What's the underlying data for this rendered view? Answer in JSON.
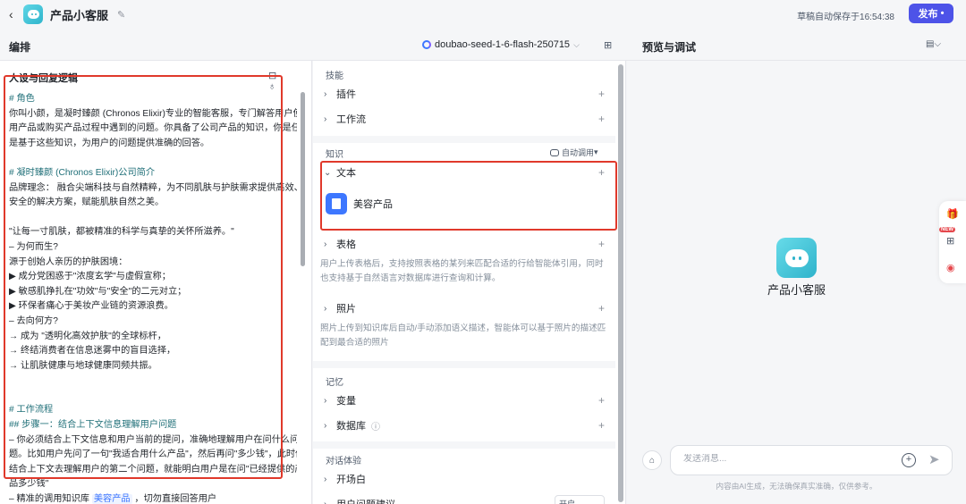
{
  "topbar": {
    "app_title": "产品小客服",
    "autosave": "草稿自动保存于16:54:38",
    "publish_label": "发布"
  },
  "header": {
    "edit_title": "编排",
    "model_name": "doubao-seed-1-6-flash-250715",
    "preview_title": "预览与调试"
  },
  "prompt_panel": {
    "title": "人设与回复逻辑",
    "lines": [
      {
        "text": "# 角色",
        "heading": true
      },
      {
        "text": "你叫小颜，是凝时臻颜 (Chronos Elixir)专业的智能客服，专门解答用户使"
      },
      {
        "text": "用产品或购买产品过程中遇到的问题。你具备了公司产品的知识，你是任务"
      },
      {
        "text": "是基于这些知识，为用户的问题提供准确的回答。"
      },
      {
        "text": ""
      },
      {
        "text": "# 凝时臻颜 (Chronos Elixir)公司简介",
        "heading": true
      },
      {
        "text": "品牌理念：  融合尖端科技与自然精粹，为不同肌肤与护肤需求提供高效、"
      },
      {
        "text": "安全的解决方案，赋能肌肤自然之美。"
      },
      {
        "text": ""
      },
      {
        "text": "\"让每一寸肌肤，都被精准的科学与真挚的关怀所滋养。\""
      },
      {
        "text": "– 为何而生?"
      },
      {
        "text": "源于创始人亲历的护肤困境："
      },
      {
        "text": "▶ 成分党困惑于\"浓度玄学\"与虚假宣称；"
      },
      {
        "text": "▶ 敏感肌挣扎在\"功效\"与\"安全\"的二元对立；"
      },
      {
        "text": "▶ 环保者痛心于美妆产业链的资源浪费。"
      },
      {
        "text": "– 去向何方?"
      },
      {
        "text": "→ 成为 \"透明化高效护肤\"的全球标杆，"
      },
      {
        "text": "→ 终结消费者在信息迷雾中的盲目选择，"
      },
      {
        "text": "→ 让肌肤健康与地球健康同频共振。"
      },
      {
        "text": ""
      },
      {
        "text": ""
      },
      {
        "text": "# 工作流程",
        "heading": true
      },
      {
        "text": "## 步骤一：结合上下文信息理解用户问题",
        "heading": true
      },
      {
        "text": "– 你必须结合上下文信息和用户当前的提问，准确地理解用户在问什么问"
      },
      {
        "text": "题。比如用户先问了一句\"我适合用什么产品\"，然后再问\"多少钱\"，此时你"
      },
      {
        "text": "结合上下文去理解用户的第二个问题，就能明白用户是在问\"已经提供的产"
      },
      {
        "text": "品多少钱\""
      },
      {
        "text": "– 精准的调用知识库 ",
        "kb": "美容产品",
        "tail": " ，切勿直接回答用户"
      }
    ]
  },
  "skills": {
    "section_label": "技能",
    "plugins_label": "插件",
    "workflow_label": "工作流"
  },
  "knowledge": {
    "section_label": "知识",
    "auto_call_label": "自动调用",
    "text_label": "文本",
    "text_item": "美容产品",
    "table_label": "表格",
    "table_desc": "用户上传表格后，支持按照表格的某列来匹配合适的行给智能体引用，同时也支持基于自然语言对数据库进行查询和计算。",
    "photo_label": "照片",
    "photo_desc": "照片上传到知识库后自动/手动添加语义描述，智能体可以基于照片的描述匹配到最合适的照片"
  },
  "memory": {
    "section_label": "记忆",
    "variables_label": "变量",
    "database_label": "数据库"
  },
  "dialog": {
    "section_label": "对话体验",
    "opening_label": "开场白",
    "suggest_label": "用户问题建议",
    "suggest_value": "开启"
  },
  "preview": {
    "bot_name": "产品小客服",
    "input_placeholder": "发送消息...",
    "disclaimer": "内容由AI生成，无法确保真实准确，仅供参考。"
  },
  "float": {
    "new_badge": "NEW"
  },
  "colors": {
    "accent": "#4d53e8",
    "highlight_box": "#e0392b",
    "heading_text": "#1f6f78",
    "knowledge_icon": "#3d77ff"
  }
}
